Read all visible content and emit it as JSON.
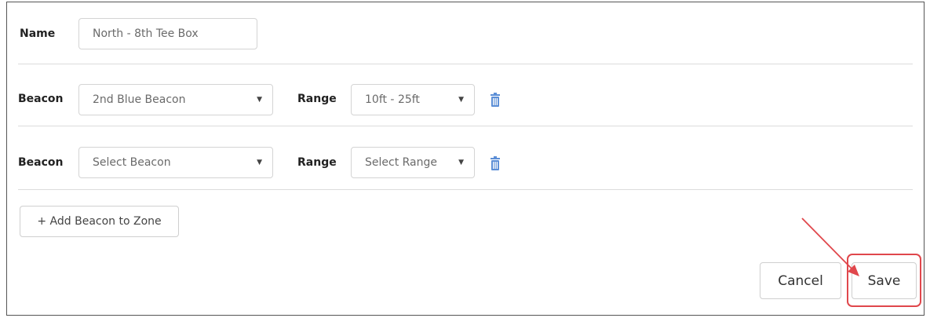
{
  "form": {
    "name_label": "Name",
    "name_value": "North - 8th Tee Box",
    "beacons": [
      {
        "beacon_label": "Beacon",
        "beacon_value": "2nd Blue Beacon",
        "range_label": "Range",
        "range_value": "10ft - 25ft"
      },
      {
        "beacon_label": "Beacon",
        "beacon_value": "Select Beacon",
        "range_label": "Range",
        "range_value": "Select Range"
      }
    ],
    "add_beacon_label": "+ Add Beacon to Zone",
    "cancel_label": "Cancel",
    "save_label": "Save"
  },
  "icons": {
    "caret": "caret-down-icon",
    "trash": "trash-icon"
  },
  "colors": {
    "trash": "#5b8ed6",
    "annotation": "#e0474c"
  }
}
